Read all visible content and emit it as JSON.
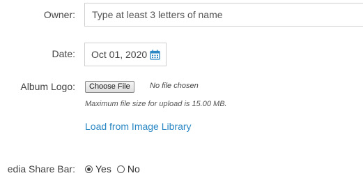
{
  "owner": {
    "label": "Owner:",
    "placeholder": "Type at least 3 letters of name",
    "value": ""
  },
  "date": {
    "label": "Date:",
    "value": "Oct 01, 2020",
    "icon": "calendar-icon",
    "icon_color": "#2a87c4"
  },
  "album_logo": {
    "label": "Album Logo:",
    "choose_label": "Choose File",
    "no_file_text": "No file chosen",
    "hint": "Maximum file size for upload is 15.00 MB.",
    "library_link": "Load from Image Library",
    "link_color": "#2a87c4"
  },
  "share_bar": {
    "label": "edia Share Bar:",
    "options": [
      {
        "label": "Yes",
        "selected": true
      },
      {
        "label": "No",
        "selected": false
      }
    ]
  }
}
